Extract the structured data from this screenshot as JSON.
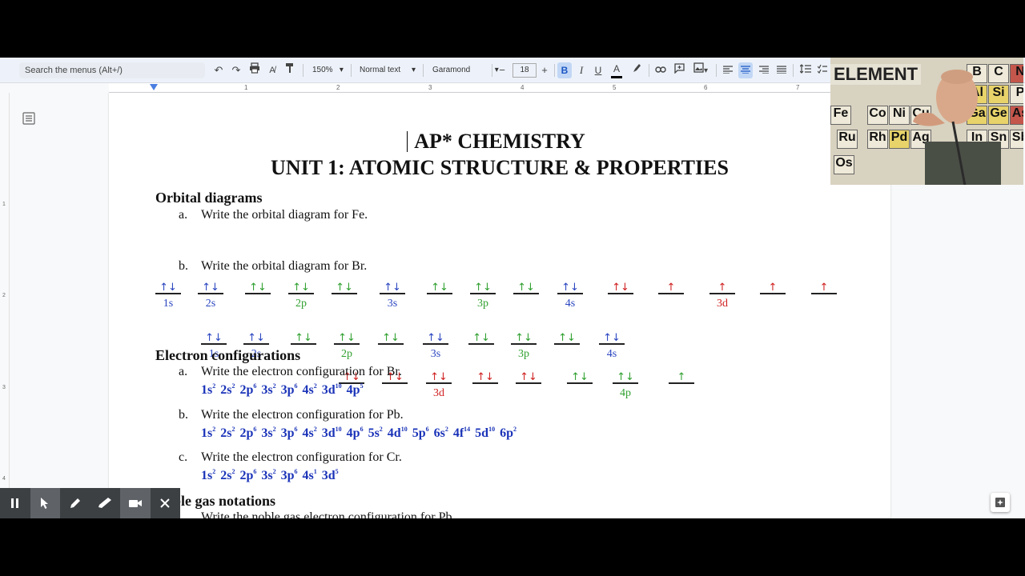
{
  "toolbar": {
    "search_placeholder": "Search the menus (Alt+/)",
    "zoom": "150%",
    "style": "Normal text",
    "font": "Garamond",
    "font_size": "18",
    "bold": "B",
    "italic": "I",
    "underline": "U",
    "text_color": "A"
  },
  "ruler": [
    "1",
    "2",
    "3",
    "4",
    "5",
    "6",
    "7"
  ],
  "vruler": [
    "1",
    "2",
    "3",
    "4"
  ],
  "document": {
    "title_line1": "AP* CHEMISTRY",
    "title_line2": "UNIT 1: ATOMIC STRUCTURE & PROPERTIES",
    "section_orbital": "Orbital diagrams",
    "q_a_letter": "a.",
    "q_a": "Write the orbital diagram for Fe.",
    "q_b_letter": "b.",
    "q_b": "Write the orbital diagram for Br.",
    "section_config": "Electron configurations",
    "ec_a_letter": "a.",
    "ec_a": "Write the electron configuration for Br.",
    "ec_b_letter": "b.",
    "ec_b": "Write the electron configuration for Pb.",
    "ec_c_letter": "c.",
    "ec_c": "Write the electron configuration for Cr.",
    "section_noble": "ble gas notations",
    "noble_a": "Write the noble gas electron configuration for Pb."
  },
  "fe_orbitals": [
    {
      "arrows": "↑↓",
      "color": "blue"
    },
    {
      "arrows": "↑↓",
      "color": "blue"
    },
    {
      "arrows": "↑↓",
      "color": "green"
    },
    {
      "arrows": "↑↓",
      "color": "green"
    },
    {
      "arrows": "↑↓",
      "color": "green"
    },
    {
      "arrows": "↑↓",
      "color": "blue"
    },
    {
      "arrows": "↑↓",
      "color": "green"
    },
    {
      "arrows": "↑↓",
      "color": "green"
    },
    {
      "arrows": "↑↓",
      "color": "green"
    },
    {
      "arrows": "↑↓",
      "color": "blue"
    },
    {
      "arrows": "↑↓",
      "color": "red"
    },
    {
      "arrows": "↑",
      "color": "red"
    },
    {
      "arrows": "↑",
      "color": "red"
    },
    {
      "arrows": "↑",
      "color": "red"
    },
    {
      "arrows": "↑",
      "color": "red"
    }
  ],
  "fe_labels": [
    {
      "text": "1s",
      "color": "blue"
    },
    {
      "text": "2s",
      "color": "blue"
    },
    {
      "text": "2p",
      "color": "green"
    },
    {
      "text": "3s",
      "color": "blue"
    },
    {
      "text": "3p",
      "color": "green"
    },
    {
      "text": "4s",
      "color": "blue"
    },
    {
      "text": "3d",
      "color": "red"
    }
  ],
  "br_row1": [
    {
      "arrows": "↑↓",
      "color": "blue"
    },
    {
      "arrows": "↑↓",
      "color": "blue"
    },
    {
      "arrows": "↑↓",
      "color": "green"
    },
    {
      "arrows": "↑↓",
      "color": "green"
    },
    {
      "arrows": "↑↓",
      "color": "green"
    },
    {
      "arrows": "↑↓",
      "color": "blue"
    },
    {
      "arrows": "↑↓",
      "color": "green"
    },
    {
      "arrows": "↑↓",
      "color": "green"
    },
    {
      "arrows": "↑↓",
      "color": "green"
    },
    {
      "arrows": "↑↓",
      "color": "blue"
    }
  ],
  "br_row1_labels": [
    {
      "text": "1s",
      "color": "blue"
    },
    {
      "text": "2s",
      "color": "blue"
    },
    {
      "text": "2p",
      "color": "green"
    },
    {
      "text": "3s",
      "color": "blue"
    },
    {
      "text": "3p",
      "color": "green"
    },
    {
      "text": "4s",
      "color": "blue"
    }
  ],
  "br_row2": [
    {
      "arrows": "↑↓",
      "color": "red"
    },
    {
      "arrows": "↑↓",
      "color": "red"
    },
    {
      "arrows": "↑↓",
      "color": "red"
    },
    {
      "arrows": "↑↓",
      "color": "red"
    },
    {
      "arrows": "↑↓",
      "color": "red"
    },
    {
      "arrows": "↑↓",
      "color": "green"
    },
    {
      "arrows": "↑↓",
      "color": "green"
    },
    {
      "arrows": "↑",
      "color": "green"
    }
  ],
  "br_row2_labels": [
    {
      "text": "3d",
      "color": "red"
    },
    {
      "text": "4p",
      "color": "green"
    }
  ],
  "configs": {
    "br": [
      [
        "1s",
        "2"
      ],
      [
        "2s",
        "2"
      ],
      [
        "2p",
        "6"
      ],
      [
        "3s",
        "2"
      ],
      [
        "3p",
        "6"
      ],
      [
        "4s",
        "2"
      ],
      [
        "3d",
        "10"
      ],
      [
        "4p",
        "5"
      ]
    ],
    "pb": [
      [
        "1s",
        "2"
      ],
      [
        "2s",
        "2"
      ],
      [
        "2p",
        "6"
      ],
      [
        "3s",
        "2"
      ],
      [
        "3p",
        "6"
      ],
      [
        "4s",
        "2"
      ],
      [
        "3d",
        "10"
      ],
      [
        "4p",
        "6"
      ],
      [
        "5s",
        "2"
      ],
      [
        "4d",
        "10"
      ],
      [
        "5p",
        "6"
      ],
      [
        "6s",
        "2"
      ],
      [
        "4f",
        "14"
      ],
      [
        "5d",
        "10"
      ],
      [
        "6p",
        "2"
      ]
    ],
    "cr": [
      [
        "1s",
        "2"
      ],
      [
        "2s",
        "2"
      ],
      [
        "2p",
        "6"
      ],
      [
        "3s",
        "2"
      ],
      [
        "3p",
        "6"
      ],
      [
        "4s",
        "1"
      ],
      [
        "3d",
        "5"
      ]
    ]
  },
  "webcam": {
    "banner": "ELEMENT",
    "cells": [
      [
        "B",
        "C",
        "N"
      ],
      [
        "Al",
        "Si",
        "P"
      ],
      [
        "Fe",
        "Co",
        "Ni",
        "Cu"
      ],
      [
        "Ga",
        "Ge",
        "As"
      ],
      [
        "Ru",
        "Rh",
        "Pd",
        "Ag"
      ],
      [
        "In",
        "Sn",
        "Sb"
      ],
      [
        "Os"
      ]
    ]
  },
  "recorder": {
    "buttons": [
      "pause-icon",
      "pointer-icon",
      "pen-icon",
      "highlighter-icon",
      "camera-icon",
      "close-icon"
    ]
  }
}
